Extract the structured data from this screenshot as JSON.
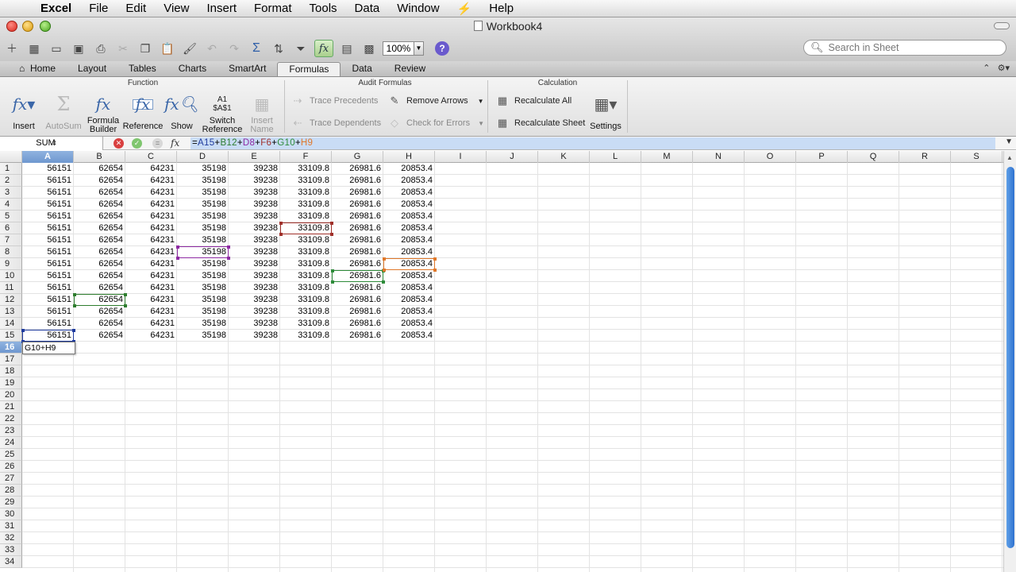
{
  "menubar": {
    "items": [
      "Excel",
      "File",
      "Edit",
      "View",
      "Insert",
      "Format",
      "Tools",
      "Data",
      "Window",
      "Help"
    ]
  },
  "window": {
    "title": "Workbook4"
  },
  "toolbar": {
    "zoom": "100%",
    "search_placeholder": "Search in Sheet"
  },
  "ribbon_tabs": [
    "Home",
    "Layout",
    "Tables",
    "Charts",
    "SmartArt",
    "Formulas",
    "Data",
    "Review"
  ],
  "active_tab": "Formulas",
  "ribbon": {
    "function_group": "Function",
    "audit_group": "Audit Formulas",
    "calc_group": "Calculation",
    "insert": "Insert",
    "autosum": "AutoSum",
    "formula_builder_1": "Formula",
    "formula_builder_2": "Builder",
    "reference": "Reference",
    "show": "Show",
    "switch_icon_1": "A1",
    "switch_icon_2": "$A$1",
    "switch_1": "Switch",
    "switch_2": "Reference",
    "insert_name_1": "Insert",
    "insert_name_2": "Name",
    "trace_precedents": "Trace Precedents",
    "trace_dependents": "Trace Dependents",
    "remove_arrows": "Remove Arrows",
    "check_errors": "Check for Errors",
    "recalc_all": "Recalculate All",
    "recalc_sheet": "Recalculate Sheet",
    "settings": "Settings"
  },
  "formula_bar": {
    "name_box": "SUM",
    "fx": "fx",
    "tokens": [
      {
        "t": "=",
        "c": "#000000"
      },
      {
        "t": "A15",
        "c": "#1f3b9e"
      },
      {
        "t": "+",
        "c": "#000000"
      },
      {
        "t": "B12",
        "c": "#2e7d2e"
      },
      {
        "t": "+",
        "c": "#000000"
      },
      {
        "t": "D8",
        "c": "#8e2aa3"
      },
      {
        "t": "+",
        "c": "#000000"
      },
      {
        "t": "F6",
        "c": "#a0302a"
      },
      {
        "t": "+",
        "c": "#000000"
      },
      {
        "t": "G10",
        "c": "#2e8b3a"
      },
      {
        "t": "+",
        "c": "#000000"
      },
      {
        "t": "H9",
        "c": "#e0782a"
      }
    ]
  },
  "columns": [
    "A",
    "B",
    "C",
    "D",
    "E",
    "F",
    "G",
    "H",
    "I",
    "J",
    "K",
    "L",
    "M",
    "N",
    "O",
    "P",
    "Q",
    "R",
    "S"
  ],
  "row_count": 34,
  "row_values": [
    "56151",
    "62654",
    "64231",
    "35198",
    "39238",
    "33109.8",
    "26981.6",
    "20853.4"
  ],
  "data_rows": 15,
  "editing_text": "G10+H9",
  "references": [
    {
      "cell": "A15",
      "color": "#1f3b9e"
    },
    {
      "cell": "B12",
      "color": "#2e7d2e"
    },
    {
      "cell": "D8",
      "color": "#8e2aa3"
    },
    {
      "cell": "F6",
      "color": "#a0302a"
    },
    {
      "cell": "G10",
      "color": "#2e8b3a"
    },
    {
      "cell": "H9",
      "color": "#e0782a"
    }
  ]
}
